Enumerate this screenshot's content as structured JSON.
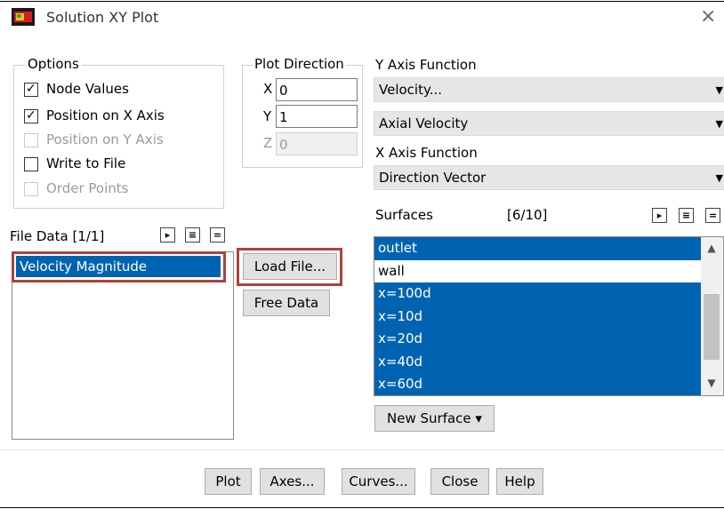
{
  "window": {
    "title": "Solution XY Plot",
    "close_glyph": "×",
    "icon": "fluent-app-icon"
  },
  "options": {
    "group_label": "Options",
    "items": [
      {
        "label": "Node Values",
        "checked": true,
        "enabled": true
      },
      {
        "label": "Position on X Axis",
        "checked": true,
        "enabled": true
      },
      {
        "label": "Position on Y Axis",
        "checked": false,
        "enabled": false
      },
      {
        "label": "Write to File",
        "checked": false,
        "enabled": true
      },
      {
        "label": "Order Points",
        "checked": false,
        "enabled": false
      }
    ]
  },
  "plot_direction": {
    "group_label": "Plot Direction",
    "x_label": "X",
    "x_value": "0",
    "y_label": "Y",
    "y_value": "1",
    "z_label": "Z",
    "z_value": "0"
  },
  "y_axis": {
    "label": "Y Axis Function",
    "category": "Velocity...",
    "function": "Axial Velocity"
  },
  "x_axis": {
    "label": "X Axis Function",
    "function": "Direction Vector"
  },
  "surfaces": {
    "label": "Surfaces",
    "count": "[6/10]",
    "items": [
      {
        "label": "outlet",
        "selected": true
      },
      {
        "label": "wall",
        "selected": false
      },
      {
        "label": "x=100d",
        "selected": true
      },
      {
        "label": "x=10d",
        "selected": true
      },
      {
        "label": "x=20d",
        "selected": true
      },
      {
        "label": "x=40d",
        "selected": true
      },
      {
        "label": "x=60d",
        "selected": true
      }
    ],
    "new_surface_label": "New Surface ▾"
  },
  "file_data": {
    "label": "File Data [1/1]",
    "items": [
      {
        "label": "Velocity Magnitude",
        "selected": true
      }
    ]
  },
  "buttons": {
    "load_file": "Load File...",
    "free_data": "Free Data",
    "plot": "Plot",
    "axes": "Axes...",
    "curves": "Curves...",
    "close": "Close",
    "help": "Help"
  },
  "list_tool_glyphs": {
    "select_all": "▸",
    "deselect_all": "≡",
    "equal": "="
  },
  "colors": {
    "selection": "#0063b1",
    "highlight_box": "#b0403c"
  }
}
